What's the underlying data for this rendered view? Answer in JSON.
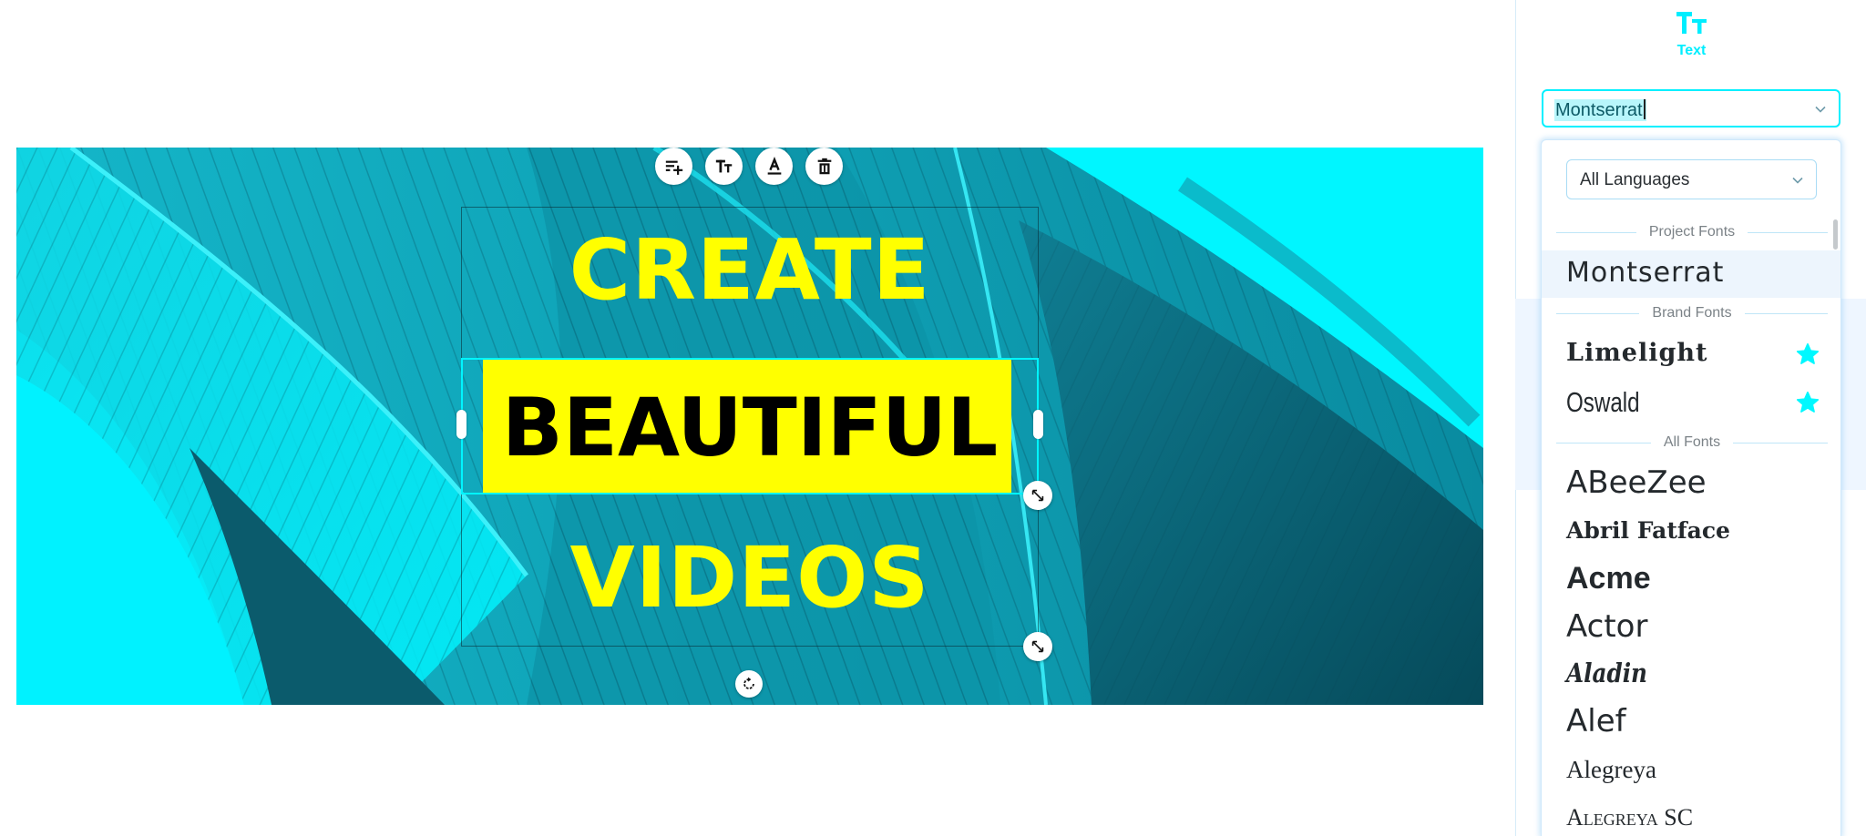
{
  "canvas": {
    "toolbar": [
      {
        "name": "add-text-button",
        "icon": "text-add-icon"
      },
      {
        "name": "text-style-button",
        "icon": "text-size-icon"
      },
      {
        "name": "text-color-button",
        "icon": "text-color-icon"
      },
      {
        "name": "delete-button",
        "icon": "trash-icon"
      }
    ],
    "text_lines": {
      "line1": "CREATE",
      "line2": "BEAUTIFUL",
      "line3": "VIDEOS"
    },
    "colors": {
      "headline_yellow": "#ffff00",
      "highlight_bg": "#ffff00",
      "highlight_text": "#000000",
      "selection": "#00f5ff"
    }
  },
  "panel": {
    "header": {
      "icon": "text-size-icon",
      "title": "Text"
    },
    "font_input": {
      "value": "Montserrat"
    },
    "dropdown": {
      "language_select": {
        "value": "All Languages"
      },
      "sections": [
        {
          "label": "Project Fonts",
          "fonts": [
            {
              "name": "Montserrat",
              "selected": true
            }
          ]
        },
        {
          "label": "Brand Fonts",
          "fonts": [
            {
              "name": "Limelight",
              "starred": true
            },
            {
              "name": "Oswald",
              "starred": true
            }
          ]
        },
        {
          "label": "All Fonts",
          "fonts": [
            {
              "name": "ABeeZee"
            },
            {
              "name": "Abril Fatface"
            },
            {
              "name": "Acme"
            },
            {
              "name": "Actor"
            },
            {
              "name": "Aladin"
            },
            {
              "name": "Alef"
            },
            {
              "name": "Alegreya"
            },
            {
              "name": "Alegreya SC"
            }
          ]
        }
      ]
    },
    "accent_color": "#00eeff"
  }
}
